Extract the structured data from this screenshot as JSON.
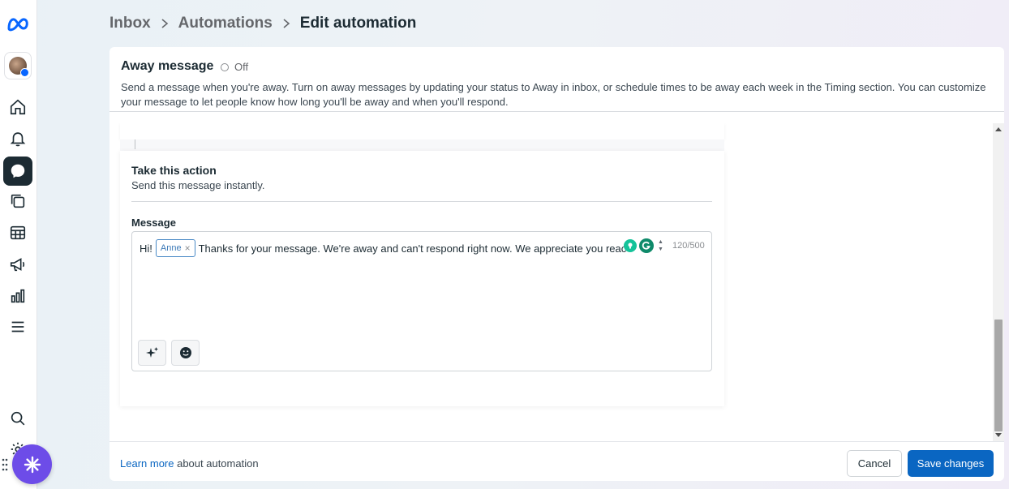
{
  "breadcrumb": {
    "items": [
      "Inbox",
      "Automations"
    ],
    "current": "Edit automation"
  },
  "header": {
    "title": "Away message",
    "toggle_state": "Off",
    "description": "Send a message when you're away. Turn on away messages by updating your status to Away in inbox, or schedule times to be away each week in the Timing section. You can customize your message to let people know how long you'll be away and when you'll respond."
  },
  "action_card": {
    "title": "Take this action",
    "subtitle": "Send this message instantly.",
    "message_label": "Message",
    "message_prefix": "Hi!",
    "name_token": "Anne",
    "message_body": "Thanks for your message. We're away and can't respond right now. We appreciate you reaching out",
    "char_count": "120/500"
  },
  "footer": {
    "learn_link": "Learn more",
    "learn_suffix": " about automation",
    "cancel_label": "Cancel",
    "save_label": "Save changes"
  },
  "sidebar": {
    "items": [
      "home-icon",
      "notifications-icon",
      "inbox-icon",
      "content-icon",
      "planner-icon",
      "ads-icon",
      "insights-icon",
      "menu-icon",
      "search-icon",
      "settings-icon"
    ],
    "active": "inbox-icon"
  },
  "colors": {
    "primary": "#0a66c2",
    "chip_border": "#4a8ac6",
    "widget": "#6d4ce8"
  }
}
